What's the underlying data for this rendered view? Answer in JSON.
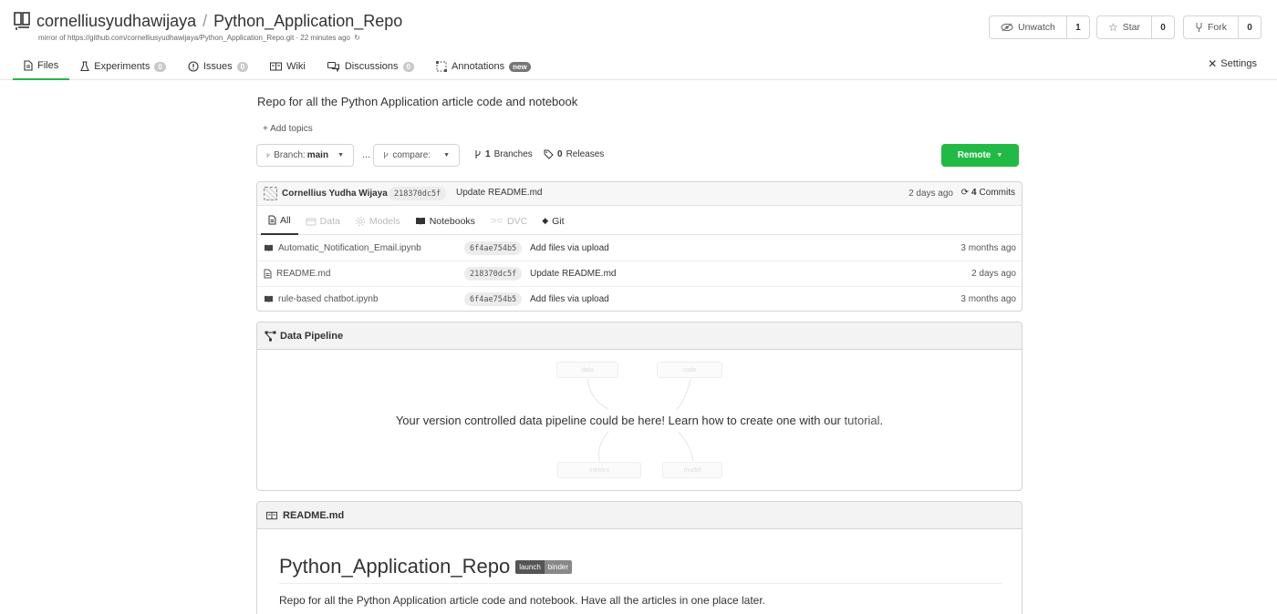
{
  "header": {
    "owner": "cornelliusyudhawijaya",
    "separator": "/",
    "repo_name": "Python_Application_Repo",
    "mirror_prefix": "mirror of",
    "mirror_url": "https://github.com/cornelliusyudhawijaya/Python_Application_Repo.git",
    "mirror_time": "· 22 minutes ago",
    "watch": {
      "label": "Unwatch",
      "count": "1"
    },
    "star": {
      "label": "Star",
      "count": "0"
    },
    "fork": {
      "label": "Fork",
      "count": "0"
    }
  },
  "tabs": [
    {
      "label": "Files",
      "icon": "file-icon",
      "badge": null
    },
    {
      "label": "Experiments",
      "icon": "flask-icon",
      "badge": "0"
    },
    {
      "label": "Issues",
      "icon": "issue-icon",
      "badge": "0"
    },
    {
      "label": "Wiki",
      "icon": "wiki-icon",
      "badge": null
    },
    {
      "label": "Discussions",
      "icon": "discussions-icon",
      "badge": "0"
    },
    {
      "label": "Annotations",
      "icon": "annotations-icon",
      "badge": "new"
    }
  ],
  "settings_label": "Settings",
  "repo": {
    "description": "Repo for all the Python Application article code and notebook",
    "add_topics": "+ Add topics",
    "branch_label": "Branch:",
    "branch_value": "main",
    "ellipsis": "...",
    "compare_label": "compare:",
    "branches_count": "1",
    "branches_label": "Branches",
    "releases_count": "0",
    "releases_label": "Releases",
    "remote_label": "Remote"
  },
  "last_commit": {
    "author": "Cornellius Yudha Wijaya",
    "sha": "218370dc5f",
    "message": "Update README.md",
    "time": "2 days ago",
    "commits_count": "4",
    "commits_label": "Commits"
  },
  "file_tabs": [
    {
      "label": "All",
      "dim": false
    },
    {
      "label": "Data",
      "dim": true
    },
    {
      "label": "Models",
      "dim": true
    },
    {
      "label": "Notebooks",
      "dim": false
    },
    {
      "label": "DVC",
      "dim": true
    },
    {
      "label": "Git",
      "dim": false
    }
  ],
  "files": [
    {
      "name": "Automatic_Notification_Email.ipynb",
      "icon": "notebook-icon",
      "sha": "6f4ae754b5",
      "message": "Add files via upload",
      "time": "3 months ago"
    },
    {
      "name": "README.md",
      "icon": "document-icon",
      "sha": "218370dc5f",
      "message": "Update README.md",
      "time": "2 days ago"
    },
    {
      "name": "rule-based chatbot.ipynb",
      "icon": "notebook-icon",
      "sha": "6f4ae754b5",
      "message": "Add files via upload",
      "time": "3 months ago"
    }
  ],
  "pipeline": {
    "title": "Data Pipeline",
    "message": "Your version controlled data pipeline could be here! Learn how to create one with our",
    "link": "tutorial",
    "period": ".",
    "ghost_nodes": [
      "data",
      "code",
      "metrics",
      "model"
    ]
  },
  "readme": {
    "header": "README.md",
    "title": "Python_Application_Repo",
    "badge_left": "launch",
    "badge_right": "binder",
    "text": "Repo for all the Python Application article code and notebook. Have all the articles in one place later."
  },
  "colors": {
    "accent_green": "#21ba45",
    "border": "#d4d4d5"
  }
}
